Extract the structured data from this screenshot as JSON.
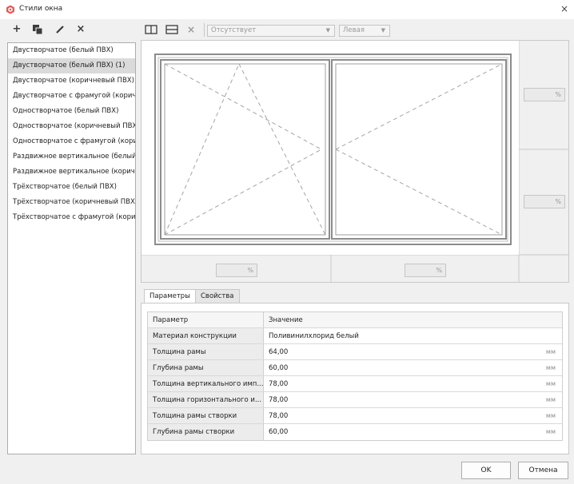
{
  "window": {
    "title": "Стили окна",
    "close": "×"
  },
  "left_toolbar": {
    "add": "+",
    "copy": "copy",
    "edit": "edit",
    "delete": "×"
  },
  "styles": [
    "Двустворчатое (белый ПВХ)",
    "Двустворчатое (белый ПВХ) (1)",
    "Двустворчатое (коричневый ПВХ)",
    "Двустворчатое с фрамугой (коричневый ПВХ)",
    "Одностворчатое (белый ПВХ)",
    "Одностворчатое (коричневый ПВХ)",
    "Одностворчатое с фрамугой (коричневый ПВХ)",
    "Раздвижное вертикальное (белый ПВХ)",
    "Раздвижное вертикальное (коричневый ПВХ)",
    "Трёхстворчатое (белый ПВХ)",
    "Трёхстворчатое (коричневый ПВХ)",
    "Трёхстворчатое с фрамугой (коричневый ПВХ)"
  ],
  "selected_style_index": 1,
  "top_toolbar": {
    "opening_dropdown": "Отсутствует",
    "side_dropdown": "Левая"
  },
  "preview": {
    "right_pct_1": "%",
    "right_pct_2": "%",
    "bottom_pct_1": "%",
    "bottom_pct_2": "%"
  },
  "tabs": [
    {
      "label": "Параметры",
      "active": true
    },
    {
      "label": "Свойства",
      "active": false
    }
  ],
  "table": {
    "header": {
      "param": "Параметр",
      "value": "Значение"
    },
    "rows": [
      {
        "name": "Материал конструкции",
        "value": "Поливинилхлорид белый",
        "unit": ""
      },
      {
        "name": "Толщина рамы",
        "value": "64,00",
        "unit": "мм"
      },
      {
        "name": "Глубина рамы",
        "value": "60,00",
        "unit": "мм"
      },
      {
        "name": "Толщина вертикального имп...",
        "value": "78,00",
        "unit": "мм"
      },
      {
        "name": "Толщина горизонтального и...",
        "value": "78,00",
        "unit": "мм"
      },
      {
        "name": "Толщина рамы створки",
        "value": "78,00",
        "unit": "мм"
      },
      {
        "name": "Глубина рамы створки",
        "value": "60,00",
        "unit": "мм"
      }
    ]
  },
  "buttons": {
    "ok": "OK",
    "cancel": "Отмена"
  },
  "colors": {
    "accent": "#d94848",
    "selection": "#dadada"
  }
}
